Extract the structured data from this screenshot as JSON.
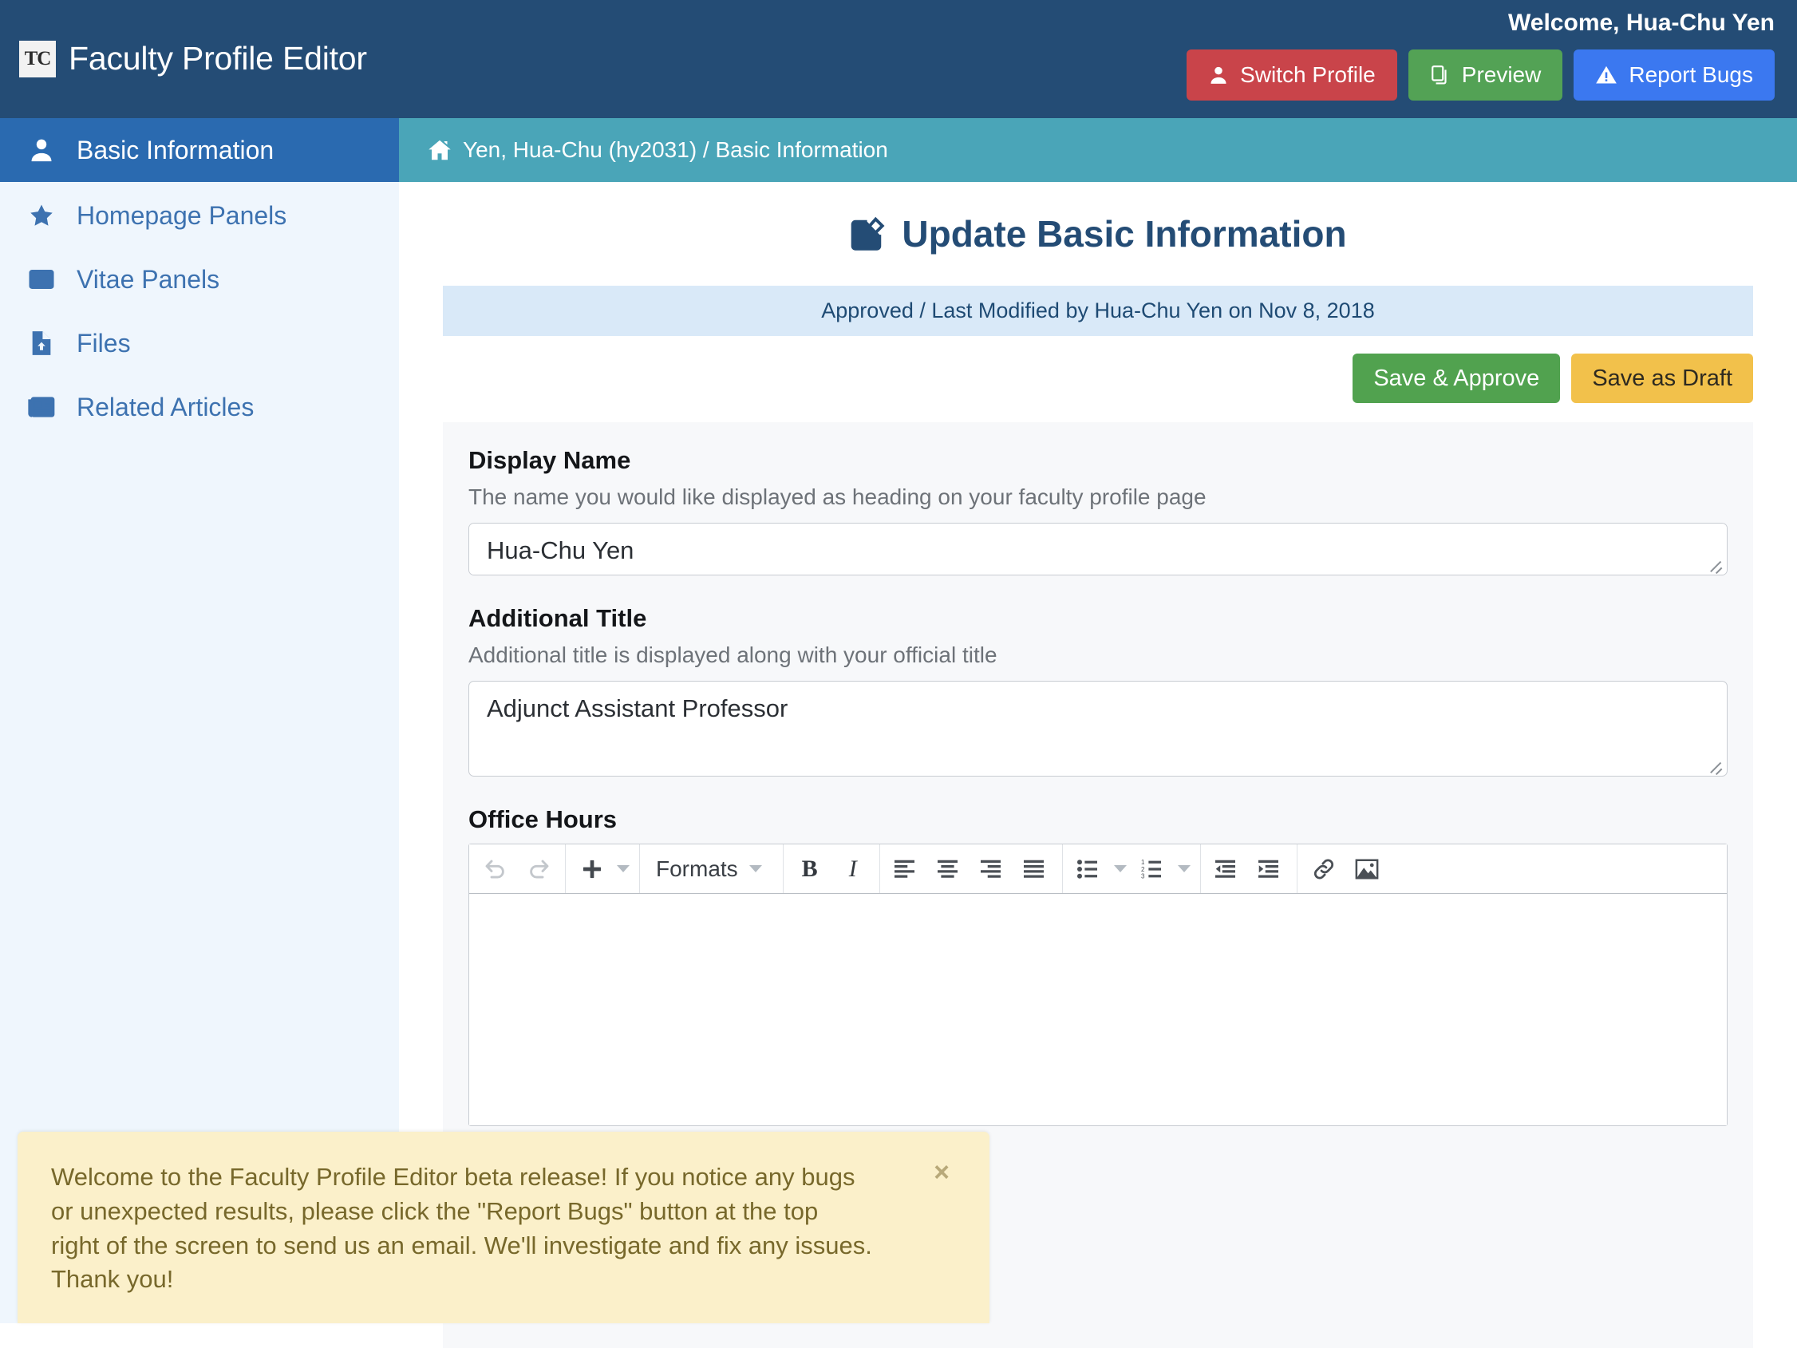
{
  "header": {
    "logo_text": "TC",
    "app_title": "Faculty Profile Editor",
    "welcome": "Welcome, Hua-Chu Yen",
    "buttons": [
      {
        "label": "Switch Profile",
        "icon": "user-icon",
        "color": "#c9444a"
      },
      {
        "label": "Preview",
        "icon": "copy-icon",
        "color": "#53a255"
      },
      {
        "label": "Report Bugs",
        "icon": "warning-triangle-icon",
        "color": "#3b78f0"
      }
    ]
  },
  "sidebar": {
    "items": [
      {
        "label": "Basic Information",
        "icon": "user-icon",
        "active": true
      },
      {
        "label": "Homepage Panels",
        "icon": "star-icon",
        "active": false
      },
      {
        "label": "Vitae Panels",
        "icon": "id-card-icon",
        "active": false
      },
      {
        "label": "Files",
        "icon": "file-upload-icon",
        "active": false
      },
      {
        "label": "Related Articles",
        "icon": "newspaper-icon",
        "active": false
      }
    ]
  },
  "breadcrumb": {
    "icon": "home-icon",
    "text": "Yen, Hua-Chu (hy2031) / Basic Information"
  },
  "main": {
    "page_title": "Update Basic Information",
    "page_title_icon": "edit-pencil-square-icon",
    "status": "Approved / Last Modified by Hua-Chu Yen on Nov 8, 2018",
    "save_approve_label": "Save & Approve",
    "save_draft_label": "Save as Draft",
    "fields": {
      "display_name": {
        "label": "Display Name",
        "help": "The name you would like displayed as heading on your faculty profile page",
        "value": "Hua-Chu Yen"
      },
      "additional_title": {
        "label": "Additional Title",
        "help": "Additional title is displayed along with your official title",
        "value": "Adjunct Assistant Professor"
      },
      "office_hours": {
        "label": "Office Hours",
        "value": ""
      }
    },
    "editor_toolbar": {
      "formats_label": "Formats",
      "buttons": [
        "undo-icon",
        "redo-icon",
        "insert-plus-icon",
        "formats-dropdown",
        "bold-icon",
        "italic-icon",
        "align-left-icon",
        "align-center-icon",
        "align-right-icon",
        "align-justify-icon",
        "bullet-list-icon",
        "numbered-list-icon",
        "outdent-icon",
        "indent-icon",
        "link-icon",
        "image-icon"
      ],
      "bold_label": "B",
      "italic_label": "I"
    }
  },
  "toast": {
    "message": "Welcome to the Faculty Profile Editor beta release! If you notice any bugs or unexpected results, please click the \"Report Bugs\" button at the top right of the screen to send us an email. We'll investigate and fix any issues. Thank you!",
    "close_label": "×"
  },
  "colors": {
    "header_bg": "#244c75",
    "breadcrumb_bg": "#4aa5b8",
    "sidebar_bg": "#eff6fd",
    "sidebar_active": "#2a6ab0",
    "status_bg": "#d9e9f8",
    "toast_bg": "#fbf0ca"
  }
}
